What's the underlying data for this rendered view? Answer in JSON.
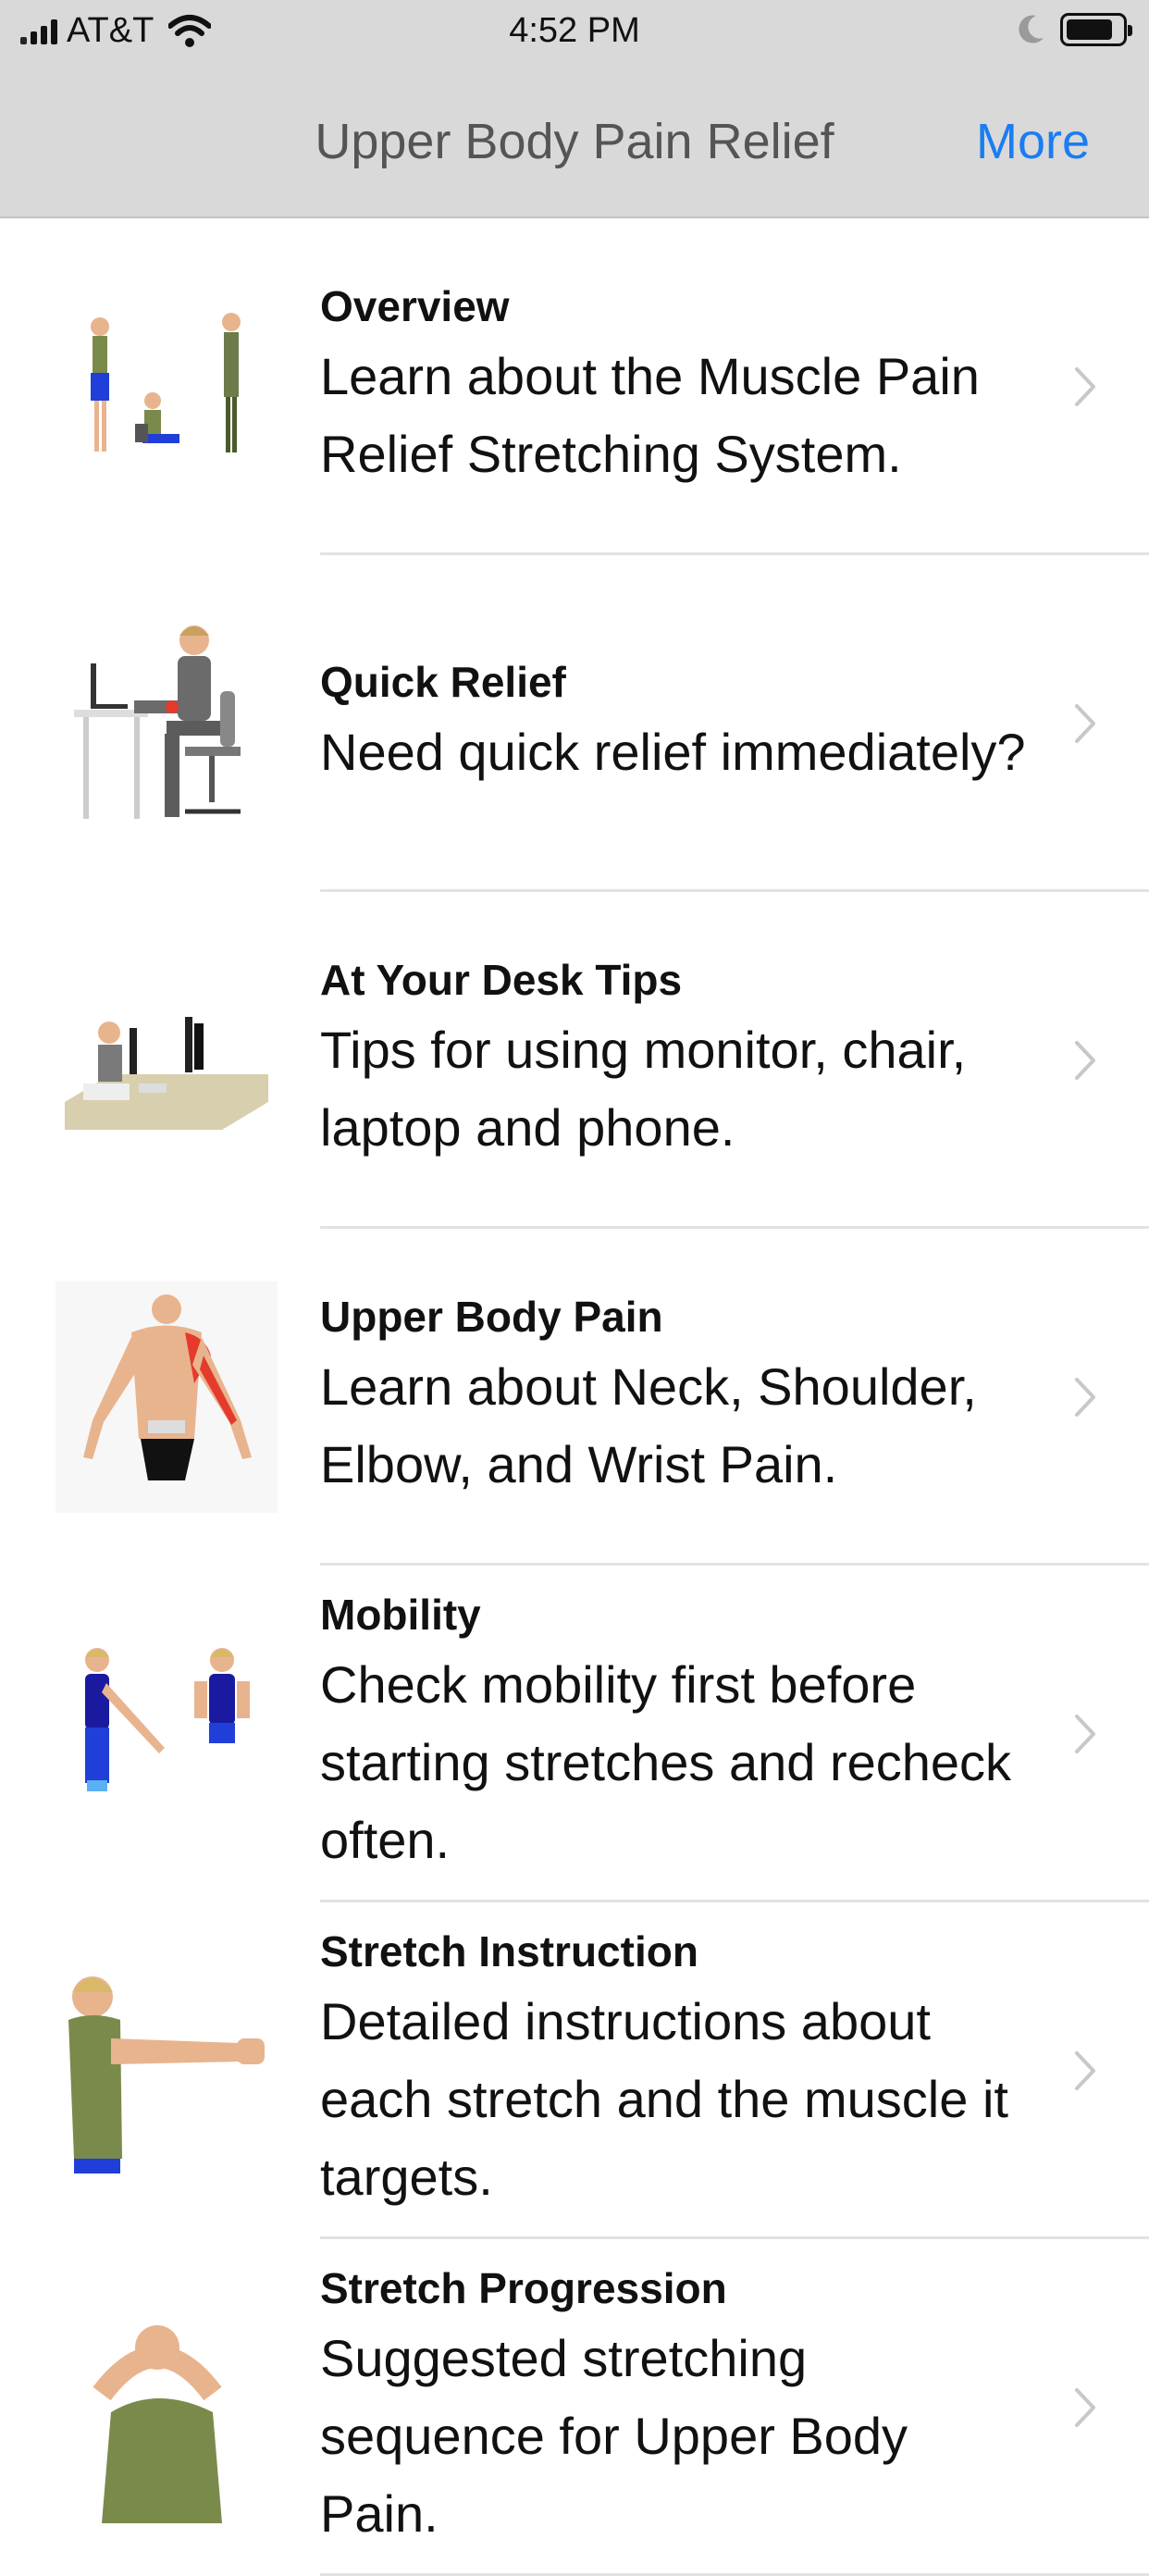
{
  "status_bar": {
    "carrier": "AT&T",
    "time": "4:52 PM",
    "battery_level": 0.85
  },
  "nav": {
    "title": "Upper Body Pain Relief",
    "more_label": "More"
  },
  "rows": [
    {
      "title": "Overview",
      "description": "Learn about the Muscle Pain Relief Stretching System.",
      "thumb": "overview-figures-illustration"
    },
    {
      "title": "Quick Relief",
      "description": "Need quick relief immediately?",
      "thumb": "person-at-desk-illustration"
    },
    {
      "title": "At Your Desk Tips",
      "description": "Tips for using monitor, chair, laptop and phone.",
      "thumb": "desk-workstation-illustration"
    },
    {
      "title": "Upper Body Pain",
      "description": "Learn about Neck, Shoulder, Elbow, and Wrist Pain.",
      "thumb": "upper-back-anatomy-illustration"
    },
    {
      "title": "Mobility",
      "description": "Check mobility first before starting stretches and recheck often.",
      "thumb": "mobility-figures-illustration"
    },
    {
      "title": "Stretch Instruction",
      "description": "Detailed instructions about each stretch and the muscle it targets.",
      "thumb": "arm-stretch-illustration"
    },
    {
      "title": "Stretch Progression",
      "description": "Suggested stretching sequence for Upper Body Pain.",
      "thumb": "neck-stretch-illustration"
    }
  ],
  "colors": {
    "accent": "#1a7df2",
    "nav_bg": "#d9d9d9",
    "chevron": "#c7c7cc",
    "separator": "#e2e2e2"
  }
}
